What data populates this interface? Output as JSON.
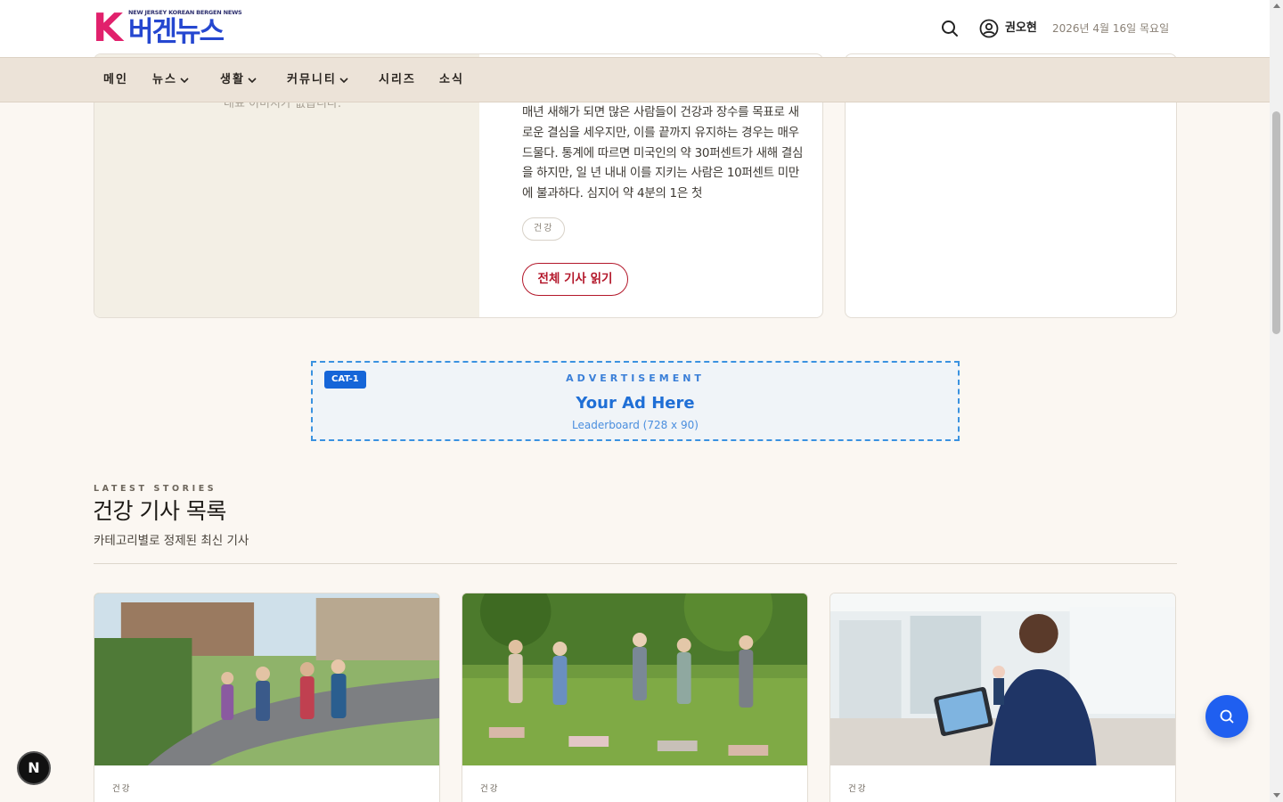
{
  "header": {
    "logo_small": "NEW JERSEY KOREAN BERGEN NEWS",
    "logo_letter": "K",
    "logo_main": "버겐뉴스",
    "user_name": "권오현",
    "date": "2026년 4월 16일 목요일"
  },
  "nav": {
    "items": [
      {
        "label": "메인",
        "has_dropdown": false
      },
      {
        "label": "뉴스",
        "has_dropdown": true
      },
      {
        "label": "생활",
        "has_dropdown": true
      },
      {
        "label": "커뮤니티",
        "has_dropdown": true
      },
      {
        "label": "시리즈",
        "has_dropdown": false
      },
      {
        "label": "소식",
        "has_dropdown": false
      }
    ]
  },
  "featured": {
    "no_image_text": "대표 이미지가 없습니다.",
    "excerpt": "매년 새해가 되면 많은 사람들이 건강과 장수를 목표로 새로운 결심을 세우지만, 이를 끝까지 유지하는 경우는 매우 드물다. 통계에 따르면 미국인의 약 30퍼센트가 새해 결심을 하지만, 일 년 내내 이를 지키는 사람은 10퍼센트 미만에 불과하다. 심지어 약 4분의 1은 첫",
    "tag": "건강",
    "read_more": "전체 기사 읽기"
  },
  "ad": {
    "badge": "CAT-1",
    "label": "ADVERTISEMENT",
    "title": "Your Ad Here",
    "size": "Leaderboard (728 x 90)",
    "accent": "#1f6fd6"
  },
  "section": {
    "eyebrow": "LATEST STORIES",
    "title": "건강 기사 목록",
    "subtitle": "카테고리별로 정제된 최신 기사"
  },
  "stories": [
    {
      "category": "건강",
      "image": "seniors-walking-photo"
    },
    {
      "category": "건강",
      "image": "seniors-yoga-photo"
    },
    {
      "category": "건강",
      "image": "nurse-tablet-photo"
    }
  ],
  "floating": {
    "next_badge": "N"
  },
  "colors": {
    "page_bg": "#fbf7f2",
    "nav_bg": "#ece3d8",
    "read_more": "#b3172a",
    "fab": "#1f5ff0"
  }
}
